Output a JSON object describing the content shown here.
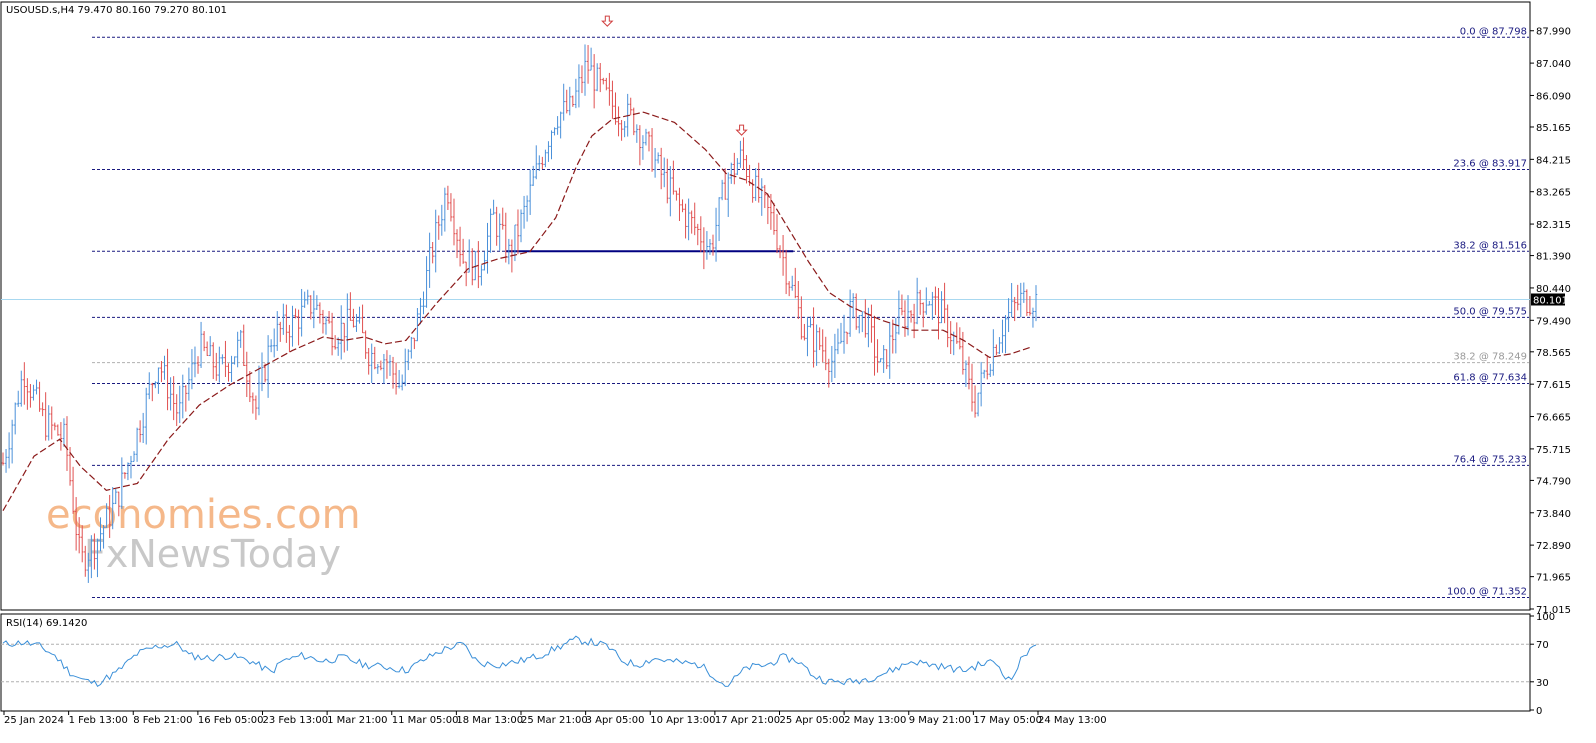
{
  "chart_data": {
    "type": "candlestick",
    "symbol_header": "USOUSD.s,H4  79.470 80.160 79.270 80.101",
    "current_price": 80.101,
    "price_label": "80.101",
    "ylim": [
      71.015,
      88.1
    ],
    "y_ticks": [
      "87.990",
      "87.040",
      "86.090",
      "85.165",
      "84.215",
      "83.265",
      "82.315",
      "81.390",
      "80.440",
      "79.490",
      "78.565",
      "77.615",
      "76.665",
      "75.715",
      "74.790",
      "73.840",
      "72.890",
      "71.965",
      "71.015"
    ],
    "y_tick_values": [
      87.99,
      87.04,
      86.09,
      85.165,
      84.215,
      83.265,
      82.315,
      81.39,
      80.44,
      79.49,
      78.565,
      77.615,
      76.665,
      75.715,
      74.79,
      73.84,
      72.89,
      71.965,
      71.015
    ],
    "x_ticks": [
      "25 Jan 2024",
      "1 Feb 13:00",
      "8 Feb 21:00",
      "16 Feb 05:00",
      "23 Feb 13:00",
      "1 Mar 21:00",
      "11 Mar 05:00",
      "18 Mar 13:00",
      "25 Mar 21:00",
      "3 Apr 05:00",
      "10 Apr 13:00",
      "17 Apr 21:00",
      "25 Apr 05:00",
      "2 May 13:00",
      "9 May 21:00",
      "17 May 05:00",
      "24 May 13:00"
    ],
    "fib_levels": [
      {
        "label": "0.0 @ 87.798",
        "value": 87.798,
        "muted": false
      },
      {
        "label": "23.6 @ 83.917",
        "value": 83.917,
        "muted": false
      },
      {
        "label": "38.2 @ 81.516",
        "value": 81.516,
        "muted": false
      },
      {
        "label": "50.0 @ 79.575",
        "value": 79.575,
        "muted": false
      },
      {
        "label": "38.2 @ 78.249",
        "value": 78.249,
        "muted": true
      },
      {
        "label": "61.8 @ 77.634",
        "value": 77.634,
        "muted": false
      },
      {
        "label": "76.4 @ 75.233",
        "value": 75.233,
        "muted": false
      },
      {
        "label": "100.0 @ 71.352",
        "value": 71.352,
        "muted": false
      }
    ],
    "neckline": {
      "value": 81.516,
      "from_bar": 0.487,
      "to_bar": 0.765
    },
    "peak_markers": [
      {
        "at": 0.585,
        "value": 87.95
      },
      {
        "at": 0.715,
        "value": 84.75
      }
    ],
    "close_path": [
      [
        0.0,
        75.3
      ],
      [
        0.02,
        78.0
      ],
      [
        0.04,
        76.5
      ],
      [
        0.06,
        76.0
      ],
      [
        0.075,
        72.4
      ],
      [
        0.09,
        73.0
      ],
      [
        0.11,
        74.2
      ],
      [
        0.13,
        76.2
      ],
      [
        0.15,
        78.3
      ],
      [
        0.17,
        76.7
      ],
      [
        0.19,
        78.7
      ],
      [
        0.21,
        78.0
      ],
      [
        0.23,
        78.8
      ],
      [
        0.245,
        76.9
      ],
      [
        0.26,
        79.0
      ],
      [
        0.28,
        79.4
      ],
      [
        0.3,
        80.0
      ],
      [
        0.32,
        79.1
      ],
      [
        0.34,
        79.5
      ],
      [
        0.355,
        78.5
      ],
      [
        0.37,
        78.4
      ],
      [
        0.385,
        77.5
      ],
      [
        0.4,
        79.3
      ],
      [
        0.415,
        81.5
      ],
      [
        0.43,
        83.4
      ],
      [
        0.445,
        81.3
      ],
      [
        0.46,
        81.0
      ],
      [
        0.475,
        82.5
      ],
      [
        0.49,
        81.4
      ],
      [
        0.505,
        82.7
      ],
      [
        0.52,
        84.2
      ],
      [
        0.535,
        85.5
      ],
      [
        0.55,
        85.7
      ],
      [
        0.565,
        87.0
      ],
      [
        0.58,
        86.2
      ],
      [
        0.595,
        85.6
      ],
      [
        0.61,
        85.4
      ],
      [
        0.625,
        84.5
      ],
      [
        0.64,
        83.6
      ],
      [
        0.655,
        82.8
      ],
      [
        0.67,
        82.2
      ],
      [
        0.685,
        81.6
      ],
      [
        0.7,
        83.6
      ],
      [
        0.715,
        84.3
      ],
      [
        0.73,
        83.2
      ],
      [
        0.745,
        82.4
      ],
      [
        0.76,
        80.8
      ],
      [
        0.775,
        79.2
      ],
      [
        0.79,
        78.8
      ],
      [
        0.805,
        78.2
      ],
      [
        0.82,
        79.8
      ],
      [
        0.835,
        79.5
      ],
      [
        0.85,
        78.0
      ],
      [
        0.865,
        79.4
      ],
      [
        0.88,
        79.8
      ],
      [
        0.895,
        80.2
      ],
      [
        0.91,
        79.6
      ],
      [
        0.925,
        78.6
      ],
      [
        0.94,
        77.0
      ],
      [
        0.955,
        78.4
      ],
      [
        0.97,
        79.5
      ],
      [
        0.985,
        80.1
      ]
    ],
    "ma_path": [
      [
        0.0,
        73.9
      ],
      [
        0.03,
        75.5
      ],
      [
        0.055,
        76.0
      ],
      [
        0.075,
        75.2
      ],
      [
        0.1,
        74.5
      ],
      [
        0.13,
        74.7
      ],
      [
        0.16,
        76.0
      ],
      [
        0.19,
        77.0
      ],
      [
        0.22,
        77.6
      ],
      [
        0.25,
        78.1
      ],
      [
        0.28,
        78.6
      ],
      [
        0.31,
        79.0
      ],
      [
        0.33,
        78.9
      ],
      [
        0.35,
        79.0
      ],
      [
        0.37,
        78.8
      ],
      [
        0.39,
        78.9
      ],
      [
        0.42,
        80.0
      ],
      [
        0.45,
        81.0
      ],
      [
        0.48,
        81.3
      ],
      [
        0.51,
        81.5
      ],
      [
        0.535,
        82.5
      ],
      [
        0.555,
        84.0
      ],
      [
        0.57,
        84.9
      ],
      [
        0.59,
        85.4
      ],
      [
        0.62,
        85.6
      ],
      [
        0.65,
        85.3
      ],
      [
        0.68,
        84.5
      ],
      [
        0.7,
        83.8
      ],
      [
        0.72,
        83.6
      ],
      [
        0.74,
        83.2
      ],
      [
        0.76,
        82.2
      ],
      [
        0.78,
        81.2
      ],
      [
        0.8,
        80.3
      ],
      [
        0.82,
        79.9
      ],
      [
        0.85,
        79.5
      ],
      [
        0.88,
        79.2
      ],
      [
        0.91,
        79.2
      ],
      [
        0.93,
        78.9
      ],
      [
        0.955,
        78.4
      ],
      [
        0.975,
        78.5
      ],
      [
        0.995,
        78.7
      ]
    ],
    "rsi": {
      "label": "RSI(14) 69.1420",
      "levels": [
        30,
        70
      ],
      "ticks": [
        "100",
        "70",
        "30",
        "0"
      ],
      "tick_values": [
        100,
        70,
        30,
        0
      ],
      "path": [
        [
          0.0,
          70
        ],
        [
          0.02,
          72
        ],
        [
          0.035,
          68
        ],
        [
          0.05,
          58
        ],
        [
          0.065,
          40
        ],
        [
          0.075,
          33
        ],
        [
          0.09,
          28
        ],
        [
          0.11,
          40
        ],
        [
          0.13,
          60
        ],
        [
          0.15,
          68
        ],
        [
          0.17,
          70
        ],
        [
          0.18,
          58
        ],
        [
          0.2,
          55
        ],
        [
          0.22,
          58
        ],
        [
          0.24,
          52
        ],
        [
          0.26,
          40
        ],
        [
          0.27,
          52
        ],
        [
          0.29,
          58
        ],
        [
          0.31,
          52
        ],
        [
          0.33,
          56
        ],
        [
          0.35,
          48
        ],
        [
          0.37,
          46
        ],
        [
          0.39,
          42
        ],
        [
          0.41,
          55
        ],
        [
          0.43,
          66
        ],
        [
          0.445,
          70
        ],
        [
          0.46,
          50
        ],
        [
          0.48,
          48
        ],
        [
          0.5,
          52
        ],
        [
          0.52,
          58
        ],
        [
          0.54,
          68
        ],
        [
          0.555,
          75
        ],
        [
          0.57,
          72
        ],
        [
          0.585,
          68
        ],
        [
          0.6,
          52
        ],
        [
          0.615,
          48
        ],
        [
          0.63,
          55
        ],
        [
          0.645,
          52
        ],
        [
          0.66,
          50
        ],
        [
          0.675,
          48
        ],
        [
          0.69,
          35
        ],
        [
          0.7,
          25
        ],
        [
          0.72,
          45
        ],
        [
          0.74,
          48
        ],
        [
          0.755,
          56
        ],
        [
          0.77,
          52
        ],
        [
          0.785,
          36
        ],
        [
          0.8,
          30
        ],
        [
          0.82,
          30
        ],
        [
          0.84,
          34
        ],
        [
          0.86,
          42
        ],
        [
          0.88,
          52
        ],
        [
          0.9,
          48
        ],
        [
          0.915,
          45
        ],
        [
          0.93,
          42
        ],
        [
          0.945,
          48
        ],
        [
          0.96,
          52
        ],
        [
          0.975,
          30
        ],
        [
          0.985,
          52
        ],
        [
          0.995,
          67
        ],
        [
          1.0,
          69.142
        ]
      ]
    },
    "watermark": [
      "economies.com",
      "FxNewsToday"
    ],
    "colors": {
      "bull": "#4a90d9",
      "bear": "#e05050",
      "ma": "#8b1a1a",
      "fib": "#1a1a80",
      "neckline": "#000080",
      "rsi": "#3a8fd8",
      "price_line": "#a8d8f0",
      "arrow": "#d04040",
      "wm1": "#f5b88a",
      "wm2": "#c8c8c8"
    }
  }
}
